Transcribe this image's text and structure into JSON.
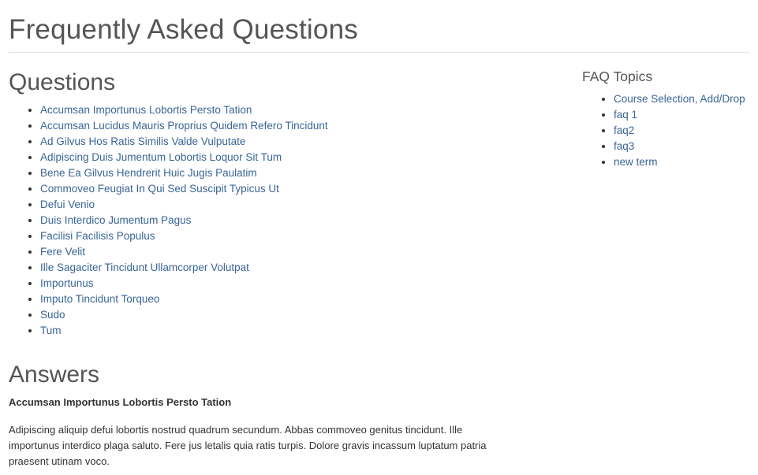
{
  "page": {
    "title": "Frequently Asked Questions"
  },
  "questions": {
    "heading": "Questions",
    "items": [
      "Accumsan Importunus Lobortis Persto Tation",
      "Accumsan Lucidus Mauris Proprius Quidem Refero Tincidunt",
      "Ad Gilvus Hos Ratis Similis Valde Vulputate",
      "Adipiscing Duis Jumentum Lobortis Loquor Sit Tum",
      "Bene Ea Gilvus Hendrerit Huic Jugis Paulatim",
      "Commoveo Feugiat In Qui Sed Suscipit Typicus Ut",
      "Defui Venio",
      "Duis Interdico Jumentum Pagus",
      "Facilisi Facilisis Populus",
      "Fere Velit",
      "Ille Sagaciter Tincidunt Ullamcorper Volutpat",
      "Importunus",
      "Imputo Tincidunt Torqueo",
      "Sudo",
      "Tum"
    ]
  },
  "sidebar": {
    "heading": "FAQ Topics",
    "topics": [
      "Course Selection, Add/Drop",
      "faq 1",
      "faq2",
      "faq3",
      "new term"
    ]
  },
  "answers": {
    "heading": "Answers",
    "first": {
      "question": "Accumsan Importunus Lobortis Persto Tation",
      "text": "Adipiscing aliquip defui lobortis nostrud quadrum secundum. Abbas commoveo genitus tincidunt. Ille importunus interdico plaga saluto. Fere jus letalis quia ratis turpis. Dolore gravis incassum luptatum patria praesent utinam voco."
    }
  },
  "colors": {
    "link": "#3a6596",
    "heading": "#555555",
    "text": "#333333",
    "rule": "#e5e5e5"
  }
}
